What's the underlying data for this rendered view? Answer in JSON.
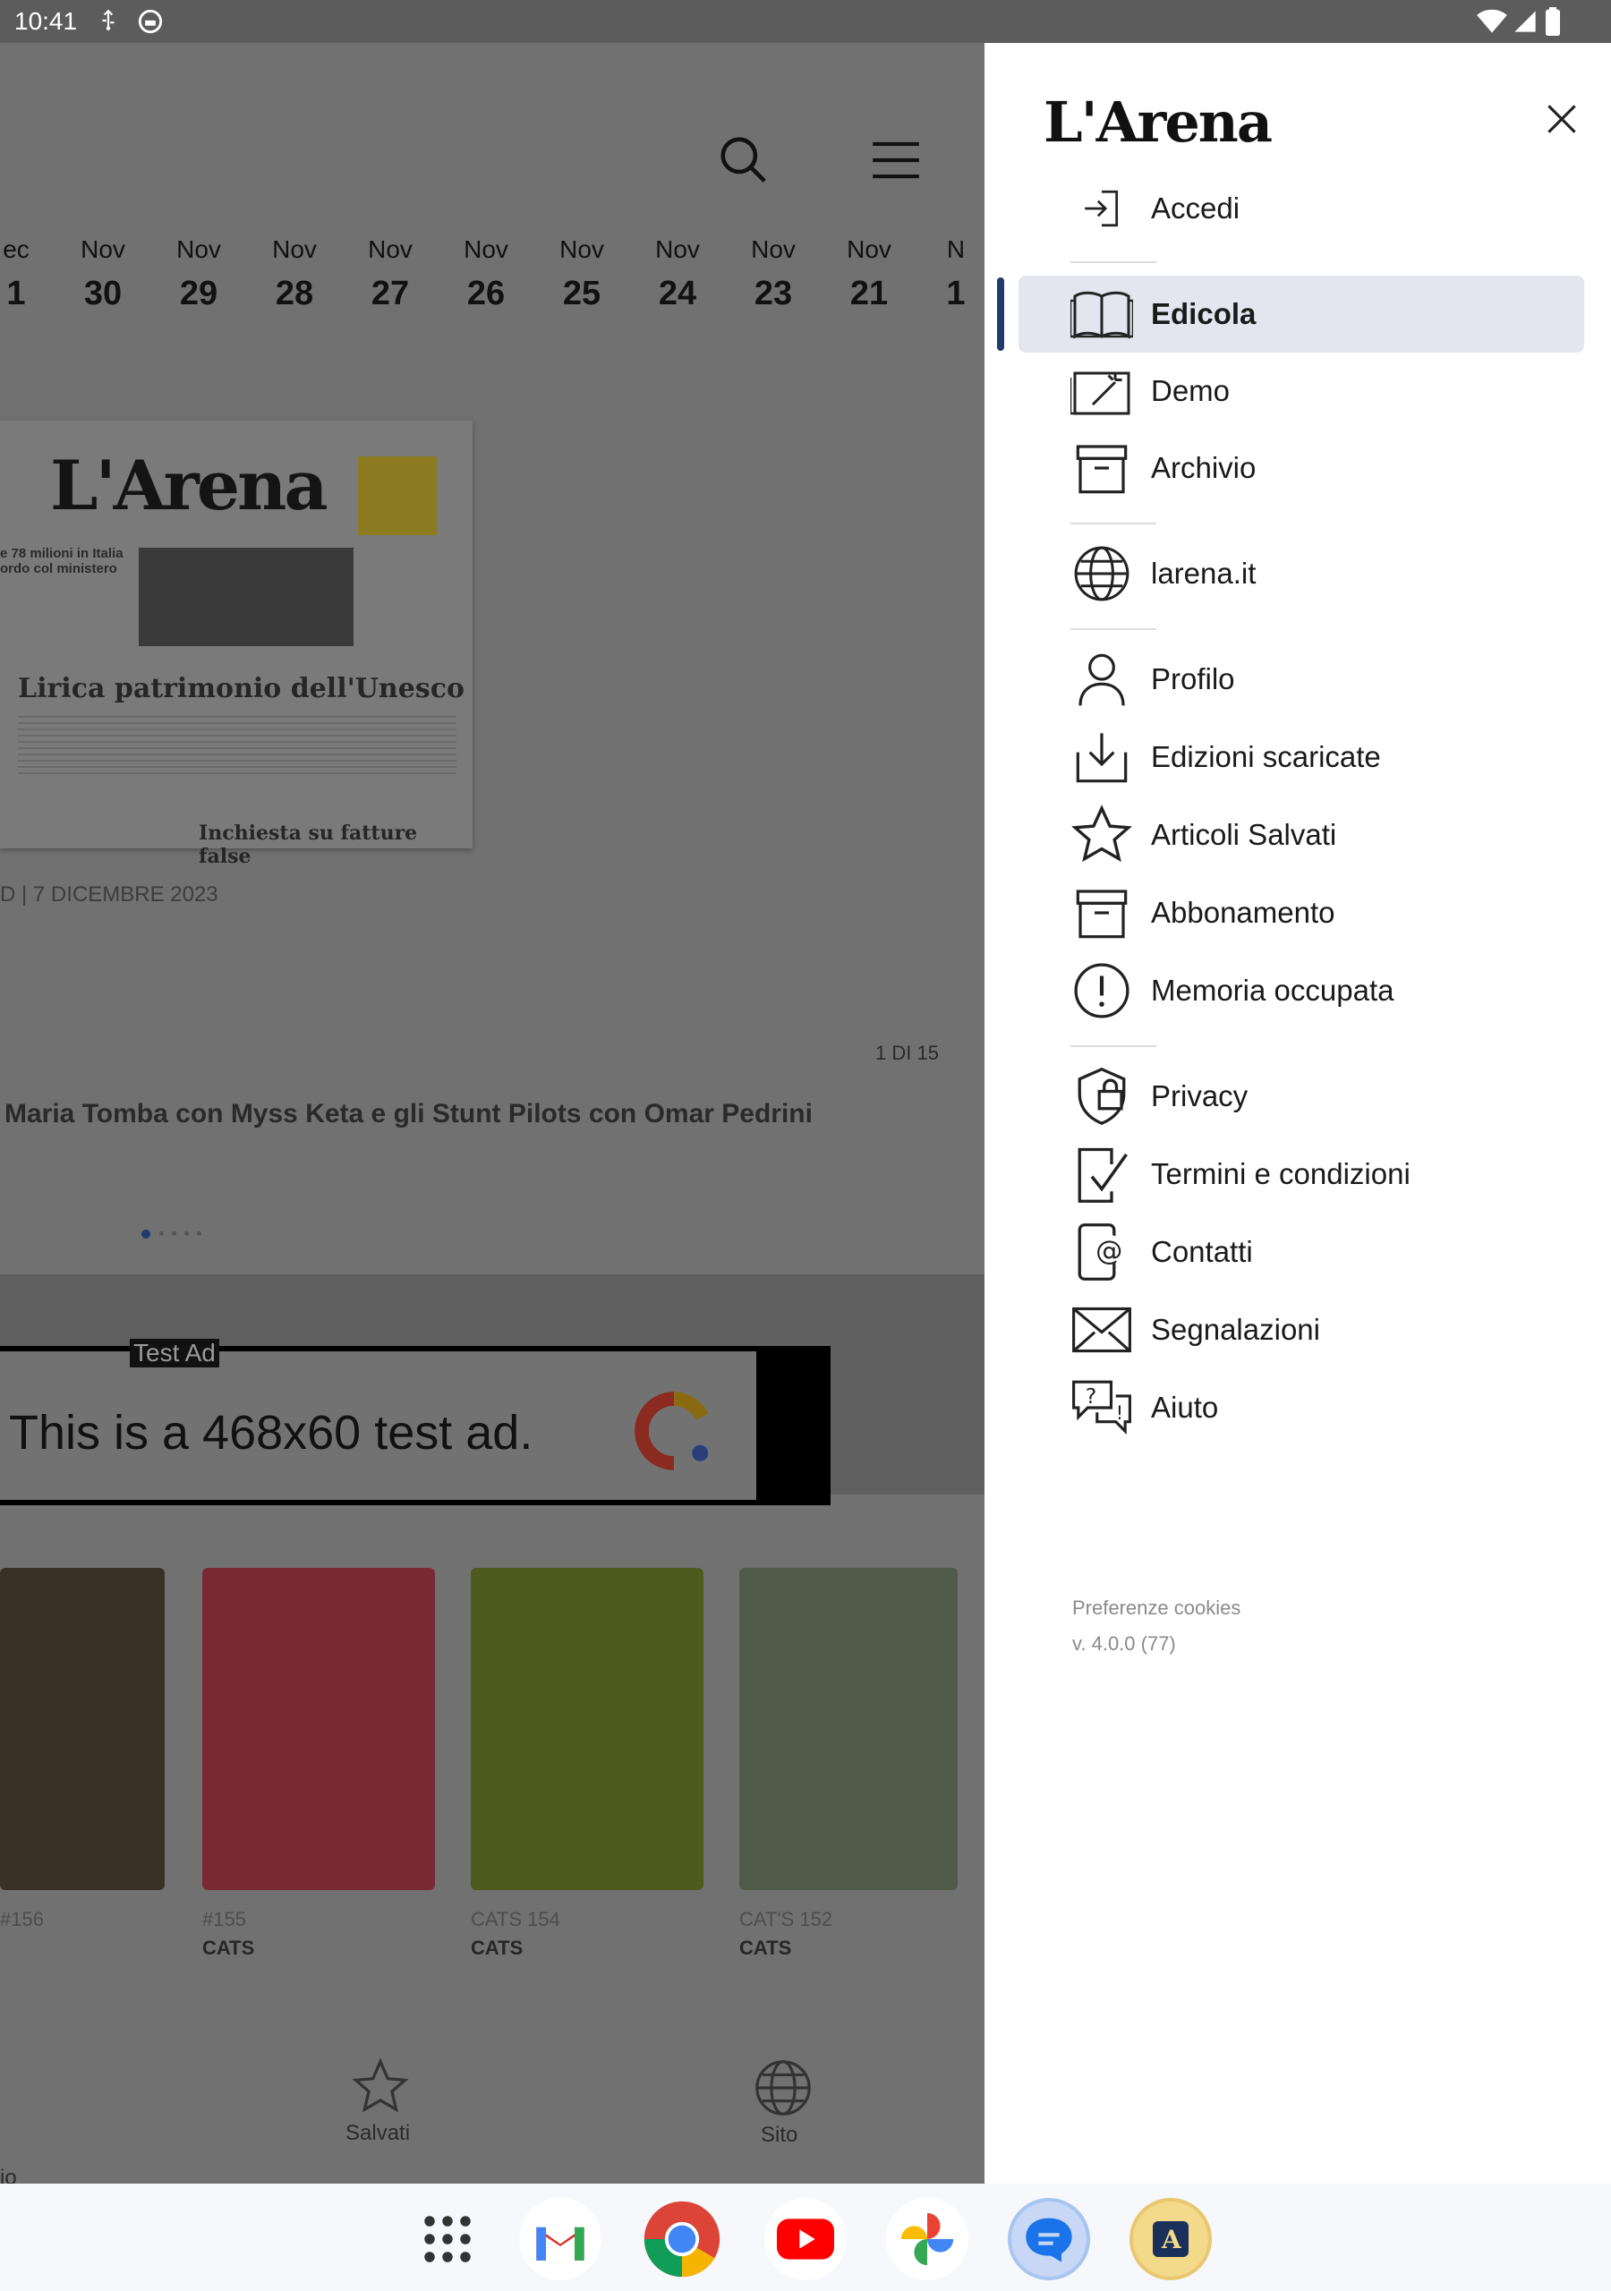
{
  "status_bar": {
    "time": "10:41"
  },
  "background": {
    "dates": [
      {
        "month": "ec",
        "day": "1"
      },
      {
        "month": "Nov",
        "day": "30"
      },
      {
        "month": "Nov",
        "day": "29"
      },
      {
        "month": "Nov",
        "day": "28"
      },
      {
        "month": "Nov",
        "day": "27"
      },
      {
        "month": "Nov",
        "day": "26"
      },
      {
        "month": "Nov",
        "day": "25"
      },
      {
        "month": "Nov",
        "day": "24"
      },
      {
        "month": "Nov",
        "day": "23"
      },
      {
        "month": "Nov",
        "day": "21"
      },
      {
        "month": "N",
        "day": "1"
      }
    ],
    "newspaper": {
      "masthead": "L'Arena",
      "headline": "Lirica patrimonio dell'Unesco",
      "headline2": "Inchiesta su fatture false",
      "side_story": "e 78 milioni in Italia ordo col ministero",
      "date": "D | 7 DICEMBRE 2023"
    },
    "counter": "1 DI 15",
    "article_title": "Maria Tomba con Myss Keta e gli Stunt Pilots con Omar Pedrini",
    "ad": {
      "badge": "Test Ad",
      "text": "This is a 468x60 test ad."
    },
    "magazines": [
      {
        "issue": "#156",
        "name": ""
      },
      {
        "issue": "#155",
        "name": "CATS"
      },
      {
        "issue": "CATS 154",
        "name": "CATS"
      },
      {
        "issue": "CAT'S 152",
        "name": "CATS"
      }
    ],
    "bottom_nav": [
      {
        "label": "io"
      },
      {
        "label": "Salvati"
      },
      {
        "label": "Sito"
      }
    ]
  },
  "drawer": {
    "logo": "L'Arena",
    "login": "Accedi",
    "items": [
      {
        "label": "Edicola",
        "icon": "book-icon",
        "active": true
      },
      {
        "label": "Demo",
        "icon": "magic-wand-icon"
      },
      {
        "label": "Archivio",
        "icon": "archive-icon"
      },
      {
        "label": "larena.it",
        "icon": "globe-icon"
      },
      {
        "label": "Profilo",
        "icon": "user-icon"
      },
      {
        "label": "Edizioni scaricate",
        "icon": "download-icon"
      },
      {
        "label": "Articoli Salvati",
        "icon": "star-icon"
      },
      {
        "label": "Abbonamento",
        "icon": "archive-icon"
      },
      {
        "label": "Memoria occupata",
        "icon": "alert-icon"
      },
      {
        "label": "Privacy",
        "icon": "shield-lock-icon"
      },
      {
        "label": "Termini e condizioni",
        "icon": "document-check-icon"
      },
      {
        "label": "Contatti",
        "icon": "phone-at-icon"
      },
      {
        "label": "Segnalazioni",
        "icon": "mail-icon"
      },
      {
        "label": "Aiuto",
        "icon": "help-chat-icon"
      }
    ],
    "cookies": "Preferenze cookies",
    "version": "v. 4.0.0 (77)"
  },
  "colors": {
    "accent": "#1f3a6b",
    "active_bg": "#e3e6ee"
  }
}
